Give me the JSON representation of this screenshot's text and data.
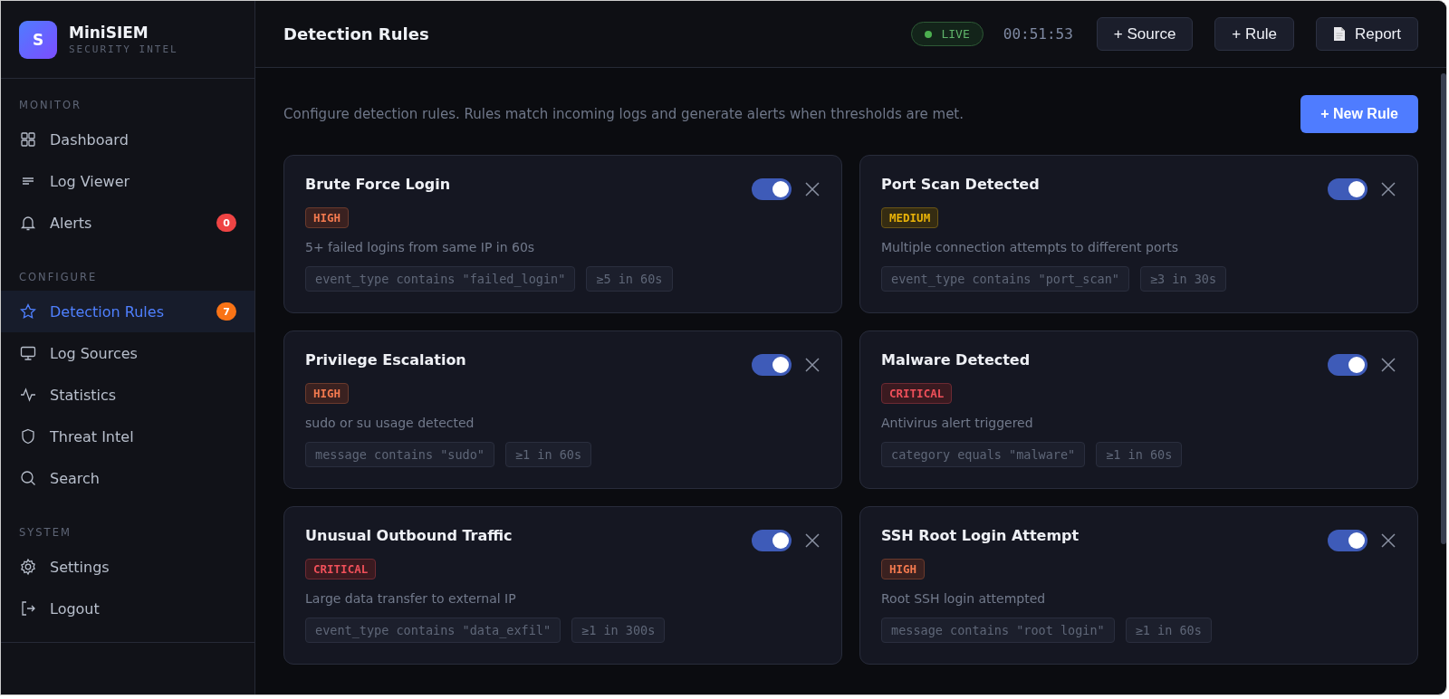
{
  "brand": {
    "logo": "S",
    "name": "MiniSIEM",
    "tagline": "SECURITY INTEL"
  },
  "sidebar": {
    "sections": [
      {
        "title": "MONITOR",
        "items": [
          {
            "label": "Dashboard",
            "selected": false
          },
          {
            "label": "Log Viewer",
            "selected": false
          },
          {
            "label": "Alerts",
            "selected": false,
            "badge": "0",
            "color": "#ef4444"
          }
        ]
      },
      {
        "title": "CONFIGURE",
        "items": [
          {
            "label": "Detection Rules",
            "selected": true,
            "badge": "7",
            "color": "#f97316"
          },
          {
            "label": "Log Sources",
            "selected": false
          },
          {
            "label": "Statistics",
            "selected": false
          },
          {
            "label": "Threat Intel",
            "selected": false
          },
          {
            "label": "Search",
            "selected": false
          }
        ]
      },
      {
        "title": "SYSTEM",
        "items": [
          {
            "label": "Settings",
            "selected": false
          },
          {
            "label": "Logout",
            "selected": false
          }
        ]
      }
    ]
  },
  "header": {
    "title": "Detection Rules",
    "live": "LIVE",
    "clock": "00:51:53",
    "buttons": [
      {
        "label": "+ Source",
        "kind": "plain"
      },
      {
        "label": "+ Rule",
        "kind": "plain"
      },
      {
        "label": "Report",
        "kind": "doc"
      }
    ]
  },
  "intro": "Configure detection rules. Rules match incoming logs and generate alerts when thresholds are met.",
  "new_rule": "+ New Rule",
  "rules": [
    {
      "name": "Brute Force Login",
      "severity": {
        "label": "HIGH",
        "kind": "high"
      },
      "on": true,
      "description": "5+ failed logins from same IP in 60s",
      "condition": "event_type contains \"failed_login\"",
      "threshold": "≥5 in 60s"
    },
    {
      "name": "Port Scan Detected",
      "severity": {
        "label": "MEDIUM",
        "kind": "medium"
      },
      "on": true,
      "description": "Multiple connection attempts to different ports",
      "condition": "event_type contains \"port_scan\"",
      "threshold": "≥3 in 30s"
    },
    {
      "name": "Privilege Escalation",
      "severity": {
        "label": "HIGH",
        "kind": "high"
      },
      "on": true,
      "description": "sudo or su usage detected",
      "condition": "message contains \"sudo\"",
      "threshold": "≥1 in 60s"
    },
    {
      "name": "Malware Detected",
      "severity": {
        "label": "CRITICAL",
        "kind": "critical"
      },
      "on": true,
      "description": "Antivirus alert triggered",
      "condition": "category equals \"malware\"",
      "threshold": "≥1 in 60s"
    },
    {
      "name": "Unusual Outbound Traffic",
      "severity": {
        "label": "CRITICAL",
        "kind": "critical"
      },
      "on": true,
      "description": "Large data transfer to external IP",
      "condition": "event_type contains \"data_exfil\"",
      "threshold": "≥1 in 300s"
    },
    {
      "name": "SSH Root Login Attempt",
      "severity": {
        "label": "HIGH",
        "kind": "high"
      },
      "on": true,
      "description": "Root SSH login attempted",
      "condition": "message contains \"root login\"",
      "threshold": "≥1 in 60s"
    }
  ]
}
